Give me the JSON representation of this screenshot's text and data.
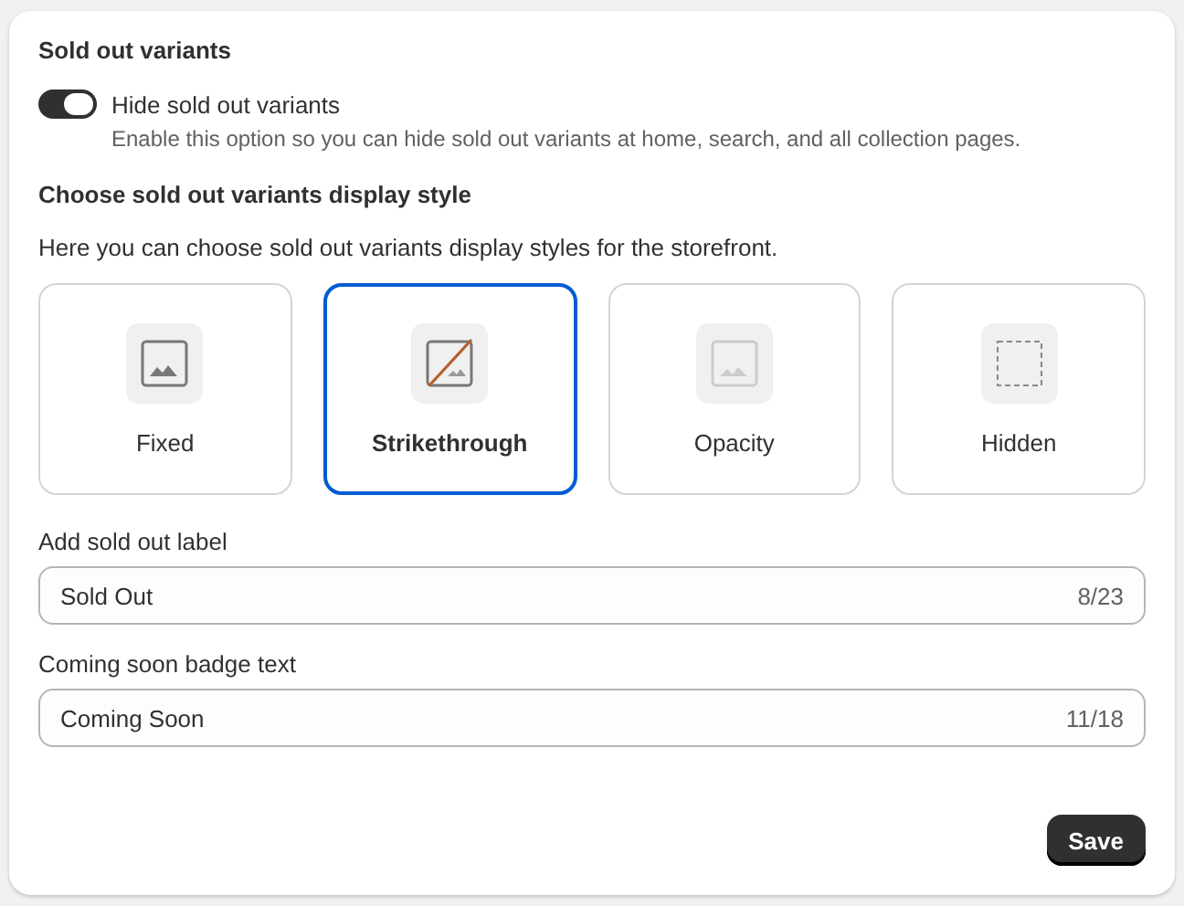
{
  "section_title": "Sold out variants",
  "toggle": {
    "label": "Hide sold out variants",
    "on": true,
    "help": "Enable this option so you can hide sold out variants at home, search, and all collection pages."
  },
  "display_style": {
    "title": "Choose sold out variants display style",
    "description": "Here you can choose sold out variants display styles for the storefront.",
    "options": [
      {
        "kind": "fixed",
        "label": "Fixed",
        "selected": false
      },
      {
        "kind": "strikethrough",
        "label": "Strikethrough",
        "selected": true
      },
      {
        "kind": "opacity",
        "label": "Opacity",
        "selected": false
      },
      {
        "kind": "hidden",
        "label": "Hidden",
        "selected": false
      }
    ]
  },
  "fields": [
    {
      "label": "Add sold out label",
      "value": "Sold Out",
      "counter": "8/23"
    },
    {
      "label": "Coming soon badge text",
      "value": "Coming Soon",
      "counter": "11/18"
    }
  ],
  "save_button": "Save"
}
